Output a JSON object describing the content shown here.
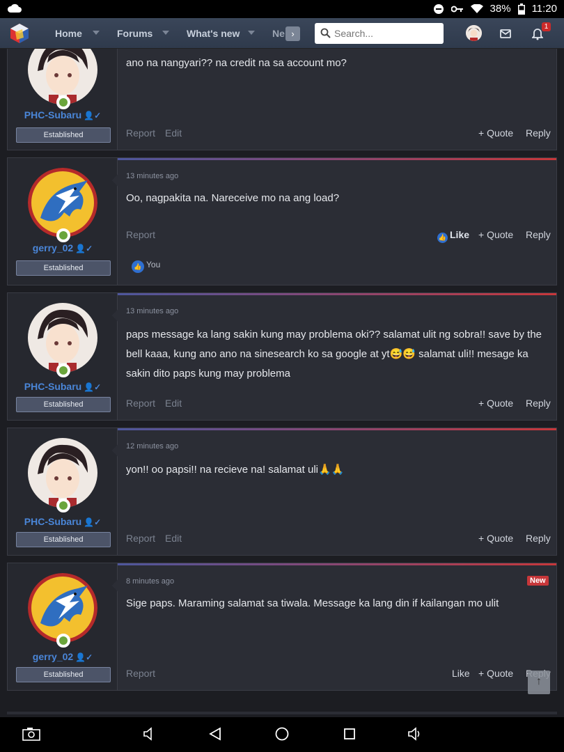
{
  "status": {
    "battery": "38%",
    "time": "11:20"
  },
  "nav": {
    "items": [
      "Home",
      "Forums",
      "What's new",
      "Ne"
    ],
    "search_placeholder": "Search...",
    "alert_count": "1"
  },
  "posts": [
    {
      "user": "PHC-Subaru",
      "title": "Established",
      "time": "",
      "message": "ano na nangyari?? na credit na sa account mo?",
      "actions_left": [
        "Report",
        "Edit"
      ],
      "quote": "Quote",
      "reply": "Reply"
    },
    {
      "user": "gerry_02",
      "title": "Established",
      "time": "13 minutes ago",
      "message": "Oo, nagpakita na. Nareceive mo na ang load?",
      "actions_left": [
        "Report"
      ],
      "like": "Like",
      "quote": "Quote",
      "reply": "Reply",
      "liked_by": "You"
    },
    {
      "user": "PHC-Subaru",
      "title": "Established",
      "time": "13 minutes ago",
      "message": "paps message ka lang sakin kung may problema oki?? salamat ulit ng sobra!! save by the bell kaaa, kung ano ano na sinesearch ko sa google at yt😅😅 salamat uli!! mesage ka sakin dito paps kung may problema",
      "actions_left": [
        "Report",
        "Edit"
      ],
      "quote": "Quote",
      "reply": "Reply"
    },
    {
      "user": "PHC-Subaru",
      "title": "Established",
      "time": "12 minutes ago",
      "message": "yon!! oo papsi!! na recieve na! salamat uli🙏🙏",
      "actions_left": [
        "Report",
        "Edit"
      ],
      "quote": "Quote",
      "reply": "Reply"
    },
    {
      "user": "gerry_02",
      "title": "Established",
      "time": "8 minutes ago",
      "message": "Sige paps. Maraming salamat sa tiwala. Message ka lang din if kailangan mo ulit",
      "actions_left": [
        "Report"
      ],
      "like": "Like",
      "quote": "Quote",
      "reply": "Reply",
      "badge": "New"
    }
  ],
  "colors": {
    "accent_blue": "#4a86d8",
    "accent_red": "#c7373a",
    "online": "#6aa53c"
  }
}
